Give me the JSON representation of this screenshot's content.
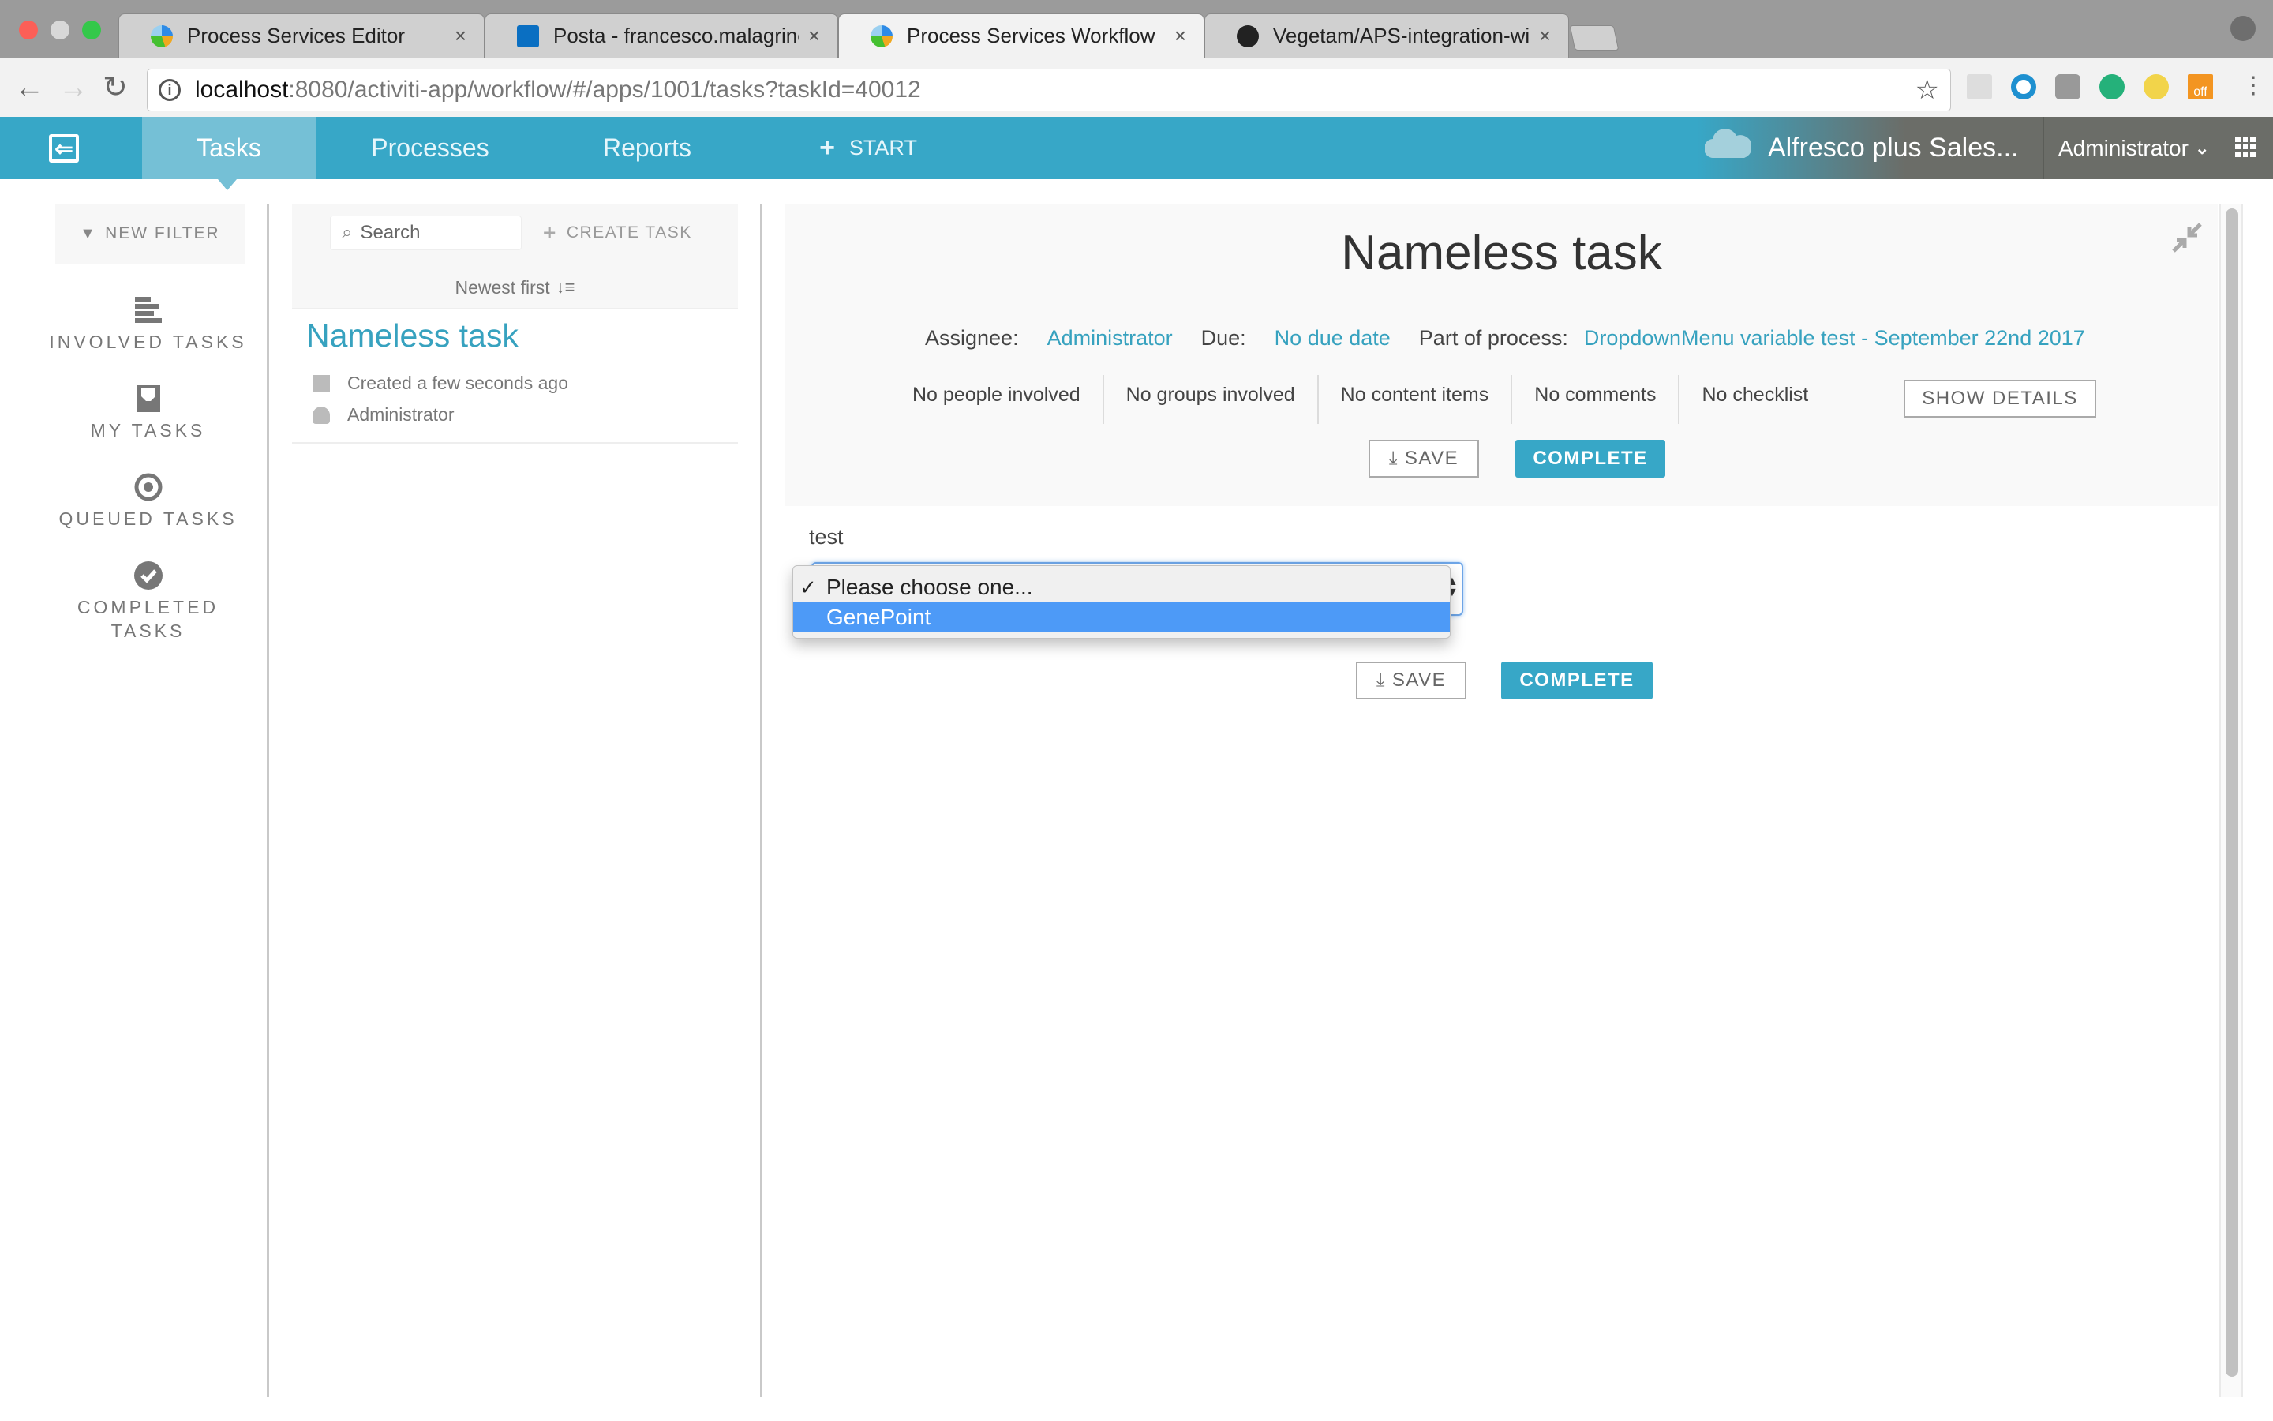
{
  "browser": {
    "tabs": [
      {
        "title": "Process Services Editor",
        "icon": "alfresco-icon",
        "active": false
      },
      {
        "title": "Posta - francesco.malagrino@a",
        "icon": "outlook-icon",
        "active": false
      },
      {
        "title": "Process Services Workflow",
        "icon": "alfresco-icon",
        "active": true
      },
      {
        "title": "Vegetam/APS-integration-with",
        "icon": "github-icon",
        "active": false
      }
    ],
    "close_glyph": "×",
    "url_host": "localhost",
    "url_path": ":8080/activiti-app/workflow/#/apps/1001/tasks?taskId=40012",
    "extension_badge": "off"
  },
  "app_header": {
    "nav": [
      {
        "label": "Tasks",
        "active": true
      },
      {
        "label": "Processes",
        "active": false
      },
      {
        "label": "Reports",
        "active": false
      }
    ],
    "start_label": "START",
    "app_name": "Alfresco plus Sales...",
    "user_name": "Administrator",
    "colors": {
      "primary": "#37a7c7",
      "active_nav": "#75c0d6",
      "user_area": "#6b6d68"
    }
  },
  "sidebar": {
    "new_filter_label": "NEW FILTER",
    "filters": [
      {
        "label": "INVOLVED TASKS",
        "icon": "list-icon"
      },
      {
        "label": "MY TASKS",
        "icon": "inbox-icon"
      },
      {
        "label": "QUEUED TASKS",
        "icon": "target-icon"
      },
      {
        "label": "COMPLETED",
        "label2": "TASKS",
        "icon": "check-circle-icon"
      }
    ]
  },
  "task_list": {
    "search_placeholder": "Search",
    "create_task_label": "CREATE TASK",
    "sort_label": "Newest first",
    "items": [
      {
        "title": "Nameless task",
        "created": "Created a few seconds ago",
        "assignee": "Administrator"
      }
    ]
  },
  "task_detail": {
    "title": "Nameless task",
    "assignee_label": "Assignee:",
    "assignee": "Administrator",
    "due_label": "Due:",
    "due": "No due date",
    "process_label": "Part of process:",
    "process": "DropdownMenu variable test - September 22nd 2017",
    "counts": [
      "No people involved",
      "No groups involved",
      "No content items",
      "No comments",
      "No checklist"
    ],
    "show_details_label": "SHOW DETAILS",
    "save_label": "SAVE",
    "complete_label": "COMPLETE"
  },
  "form": {
    "field_label": "test",
    "dropdown_options": [
      {
        "label": "Please choose one...",
        "checked": true,
        "highlighted": false
      },
      {
        "label": "GenePoint",
        "checked": false,
        "highlighted": true
      }
    ],
    "check_glyph": "✓",
    "save_label": "SAVE",
    "complete_label": "COMPLETE"
  }
}
